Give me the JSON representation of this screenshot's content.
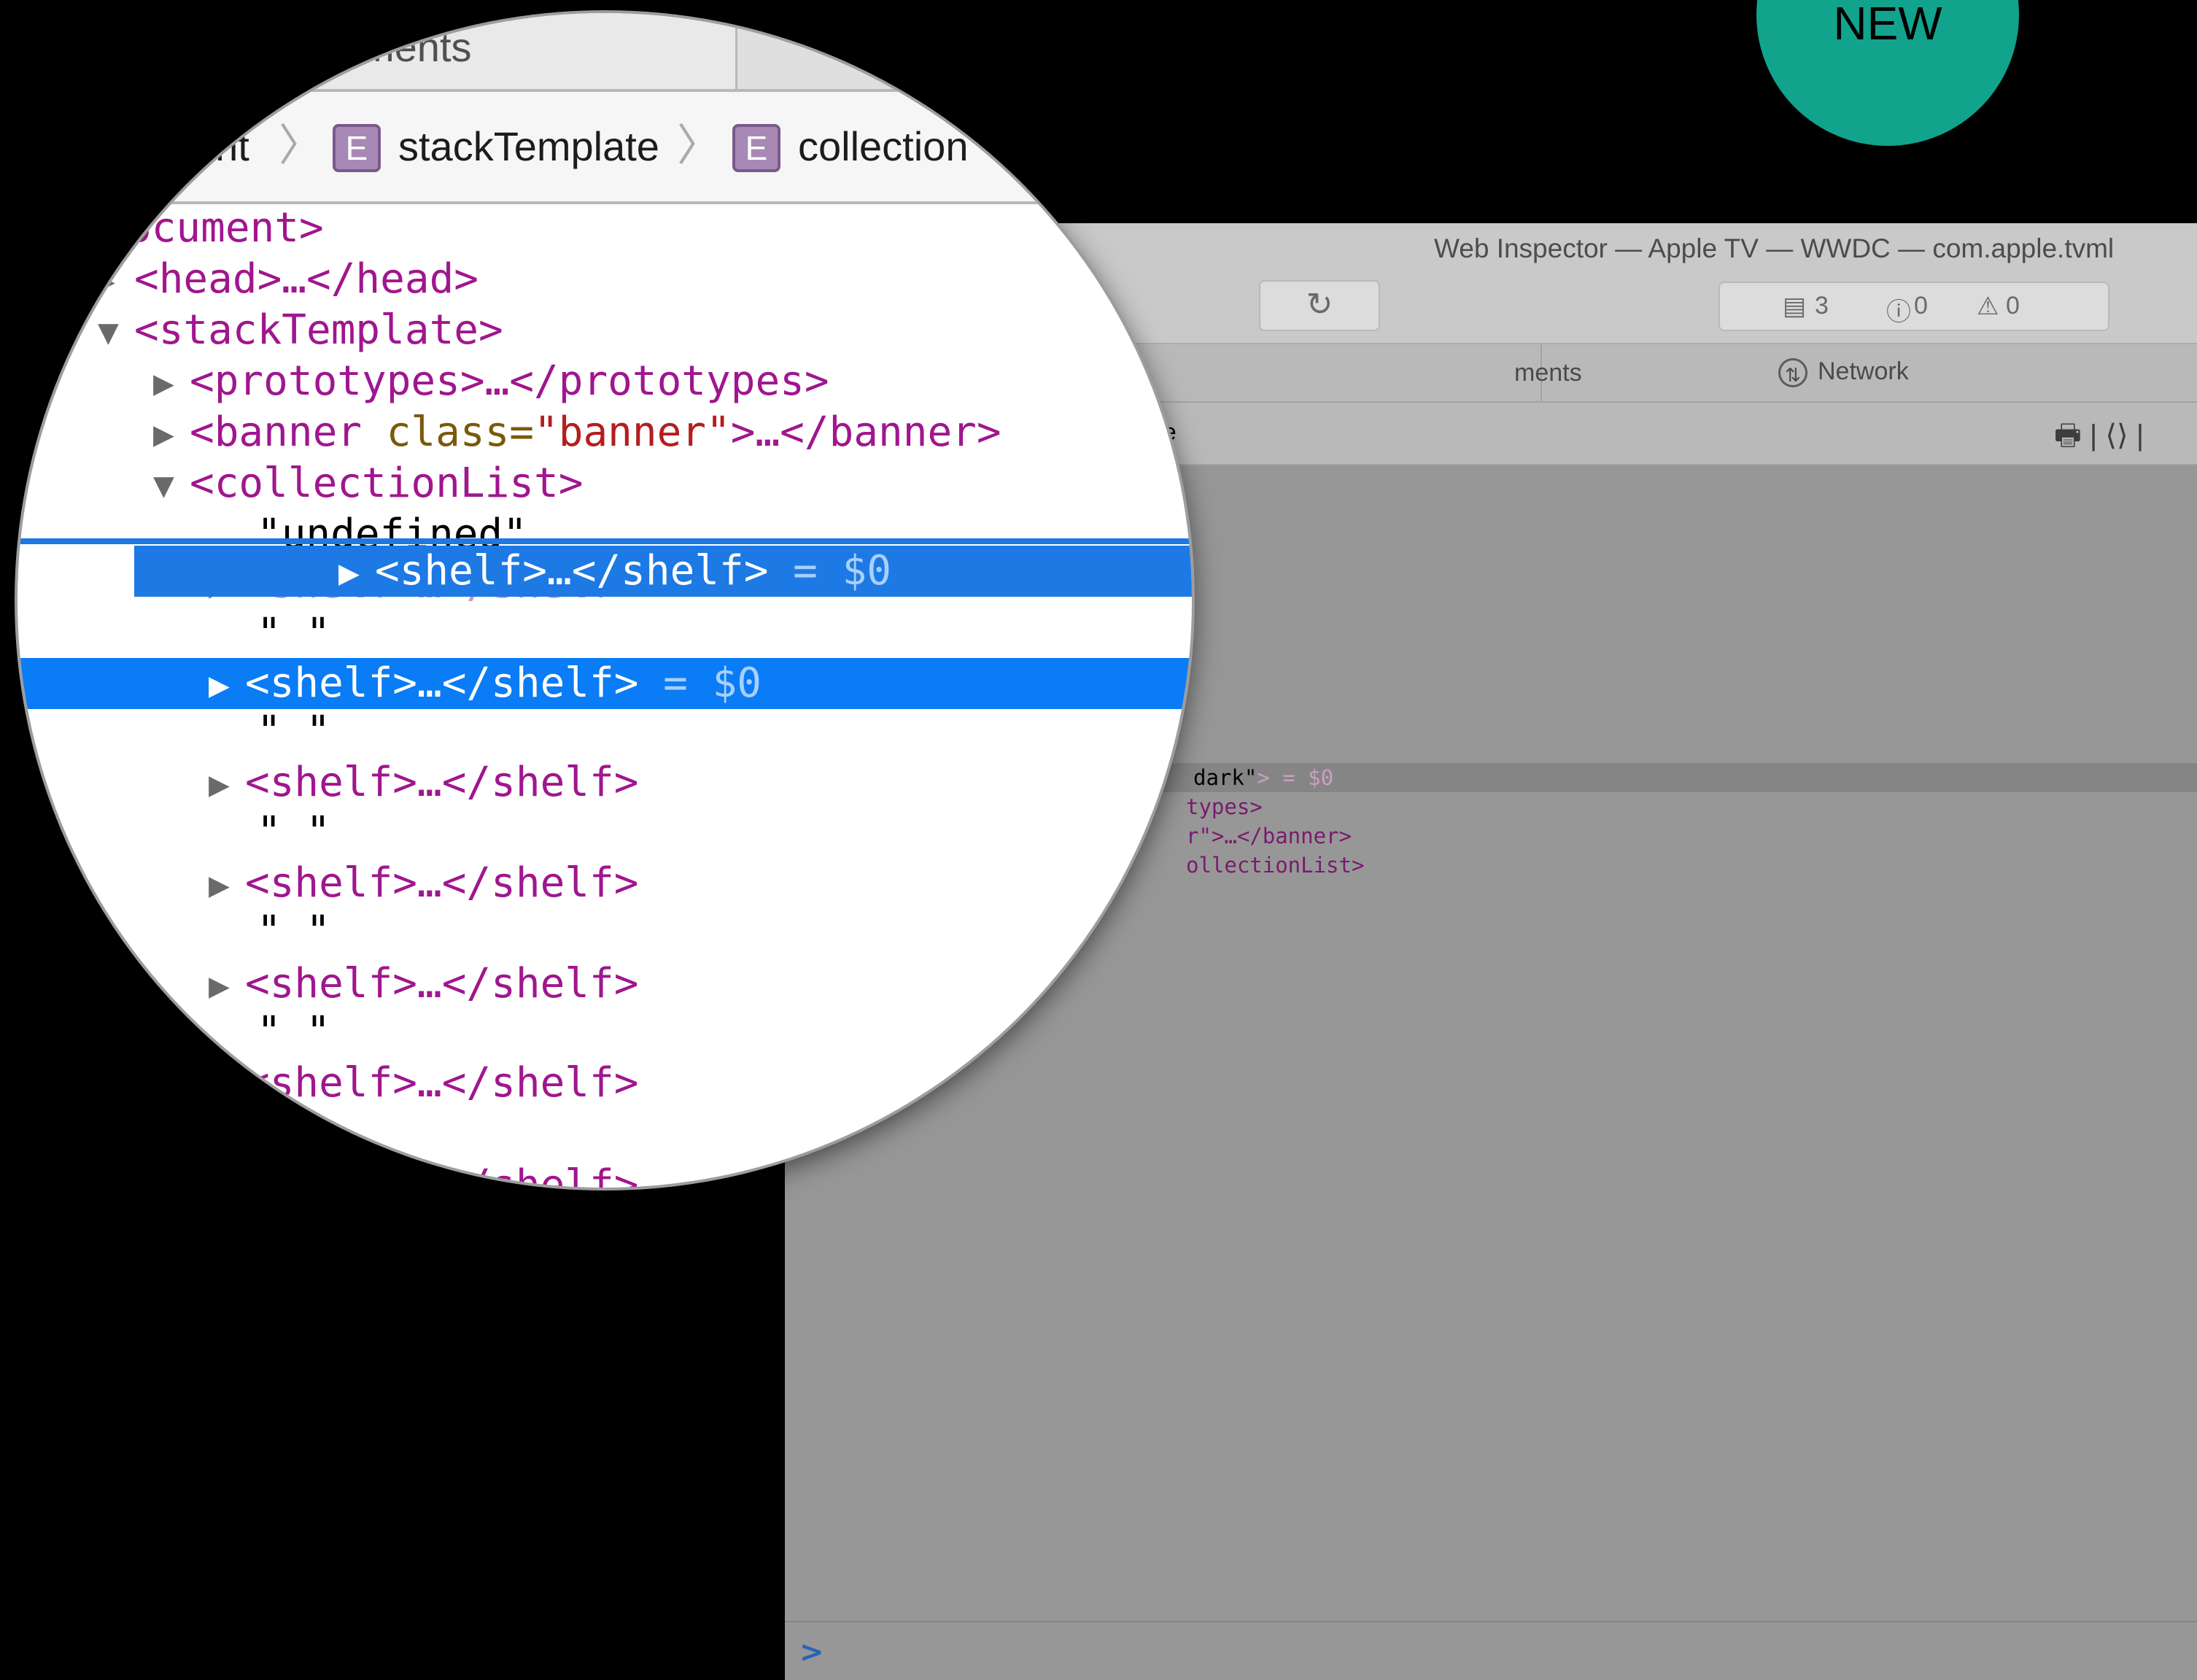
{
  "badge": {
    "label": "NEW"
  },
  "window": {
    "title": "Web Inspector — Apple TV — WWDC — com.apple.tvml",
    "reload_icon": "reload-icon",
    "counts": {
      "logs": "3",
      "errors": "0",
      "warnings": "0"
    },
    "tabs": {
      "elements": "ments",
      "network": "Network"
    },
    "crumb_fragment": "te",
    "dom_rows": [
      "dark\"",
      "> = $0",
      "types>",
      "r\">…</banner>",
      "ollectionList>"
    ],
    "prompt": ">"
  },
  "magnifier": {
    "tab_label": "ments",
    "breadcrumbs": [
      {
        "label": "ent",
        "icon": "E"
      },
      {
        "label": "stackTemplate",
        "icon": "E"
      },
      {
        "label": "collection",
        "icon": "E"
      }
    ],
    "dom": {
      "document": "ocument>",
      "head": "<head>…</head>",
      "stack": "<stackTemplate>",
      "prototypes": "<prototypes>…</prototypes>",
      "banner_open": "<banner ",
      "banner_attr": "class=",
      "banner_val": "\"banner\"",
      "banner_close": ">…</banner>",
      "collection": "<collectionList>",
      "undefined": "\"undefined\"",
      "shelf": "<shelf>…</shelf>",
      "shelf_sel": "<shelf>…</shelf>",
      "sel_suffix": " = $0",
      "space": "\" \""
    }
  }
}
